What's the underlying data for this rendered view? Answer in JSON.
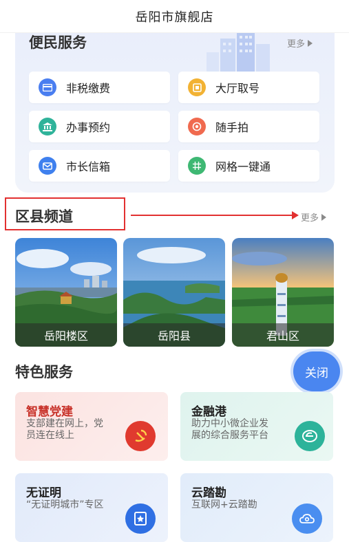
{
  "header": {
    "title": "岳阳市旗舰店"
  },
  "convenience": {
    "title": "便民服务",
    "more": "更多",
    "items": [
      {
        "label": "非税缴费",
        "icon": "card-icon",
        "color": "#4a7ef0"
      },
      {
        "label": "大厅取号",
        "icon": "ticket-icon",
        "color": "#f2b233"
      },
      {
        "label": "办事预约",
        "icon": "bank-icon",
        "color": "#2fb39a"
      },
      {
        "label": "随手拍",
        "icon": "camera-icon",
        "color": "#f06a4f"
      },
      {
        "label": "市长信箱",
        "icon": "mail-icon",
        "color": "#3f80ee"
      },
      {
        "label": "网格一键通",
        "icon": "grid-icon",
        "color": "#3eb873"
      }
    ]
  },
  "districts": {
    "title": "区县频道",
    "more": "更多",
    "items": [
      {
        "label": "岳阳楼区"
      },
      {
        "label": "岳阳县"
      },
      {
        "label": "君山区"
      }
    ]
  },
  "featured": {
    "title": "特色服务",
    "close": "关闭",
    "items": [
      {
        "title": "智慧党建",
        "desc_lines": [
          "支部建在网上，党",
          "员连在线上"
        ],
        "title_color": "#c8322a",
        "icon": "party-emblem-icon"
      },
      {
        "title": "金融港",
        "desc_lines": [
          "助力中小微企业发",
          "展的综合服务平台"
        ],
        "title_color": "#222222",
        "icon": "finance-e-icon"
      },
      {
        "title": "无证明",
        "desc_lines": [
          "“无证明城市”专区"
        ],
        "title_color": "#222222",
        "icon": "certificate-icon"
      },
      {
        "title": "云踏勘",
        "desc_lines": [
          "互联网+云踏勘"
        ],
        "title_color": "#222222",
        "icon": "cloud-icon"
      }
    ]
  }
}
